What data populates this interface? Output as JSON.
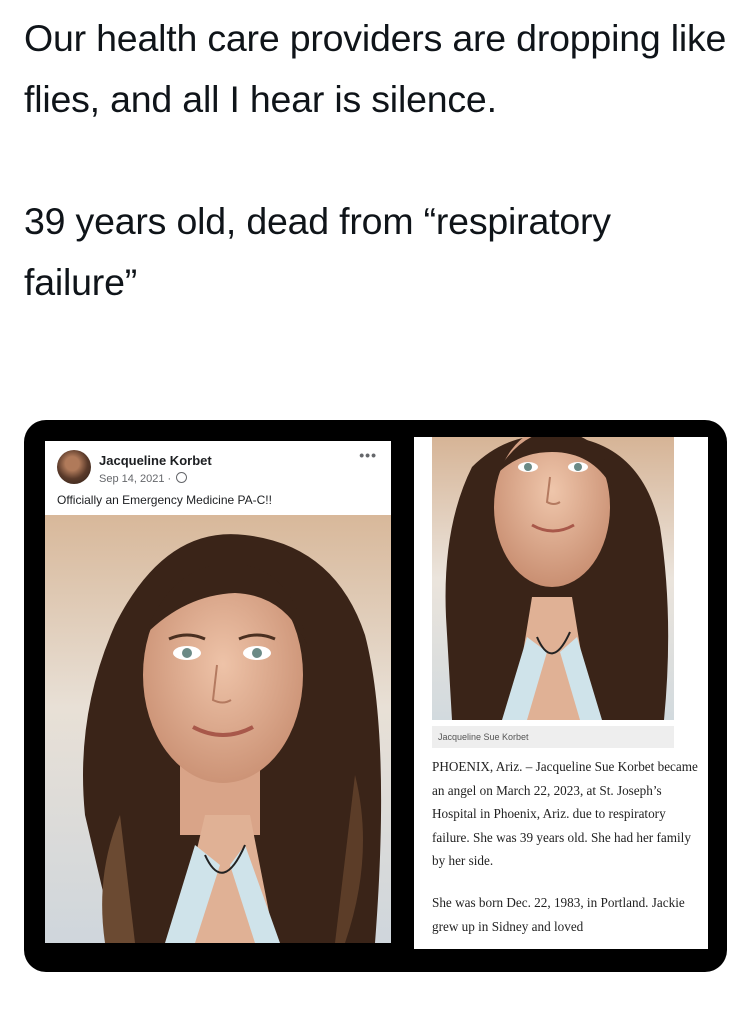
{
  "tweet": {
    "para1": "Our health care providers are dropping like flies, and all I hear is silence.",
    "para2": "39 years old, dead from “respiratory failure”"
  },
  "facebook_post": {
    "author": "Jacqueline Korbet",
    "date": "Sep 14, 2021 ·",
    "privacy_icon": "globe-icon",
    "more_icon": "more-options-icon",
    "more_label": "•••",
    "caption": "Officially an Emergency Medicine PA-C!!"
  },
  "obituary": {
    "photo_caption": "Jacqueline Sue Korbet",
    "paragraph1": "PHOENIX, Ariz. – Jacqueline Sue Korbet became an angel on March 22, 2023, at St. Joseph’s Hospital in Phoenix, Ariz. due to respiratory failure. She was 39 years old. She had her family by her side.",
    "paragraph2": "She was born Dec. 22, 1983, in Portland. Jackie grew up in Sidney and loved"
  },
  "colors": {
    "frame": "#000000",
    "text": "#0f1419",
    "fb_secondary": "#65676b",
    "hair": "#3a2418",
    "skin": "#e3b49a"
  }
}
